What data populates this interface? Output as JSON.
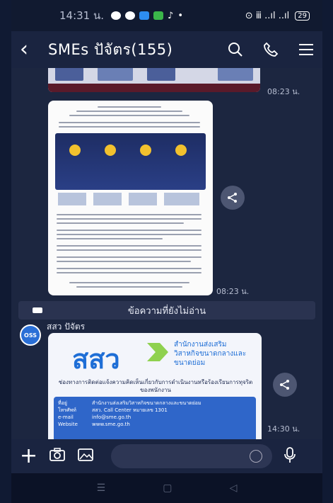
{
  "status_bar": {
    "time": "14:31 น.",
    "right": "⊙ ⅲ ..ıl ..ıl",
    "battery": "29"
  },
  "header": {
    "title": "SMEs ปัจัตร(155)"
  },
  "messages": {
    "img_time": "08:23 น.",
    "doc_time": "08:23 น.",
    "card_time": "14:30 น."
  },
  "unread_divider": "ข้อความที่ยังไม่อ่าน",
  "sender": {
    "name": "สสว ปัจัตร",
    "avatar_text": "OSS"
  },
  "card": {
    "logo": "สสว",
    "org": "สำนักงานส่งเสริมวิสาหกิจขนาดกลางและขนาดย่อม",
    "intro": "ช่องทางการติดต่อแจ้งความคิดเห็นเกี่ยวกับการดำเนินงานหรือร้องเรียนการทุจริตของพนักงาน",
    "rows": [
      {
        "k": "ที่อยู่",
        "v": "สำนักงานส่งเสริมวิสาหกิจขนาดกลางและขนาดย่อม"
      },
      {
        "k": "โทรศัพท์",
        "v": "สสว. Call Center หมายเลข 1301"
      },
      {
        "k": "e-mail",
        "v": "info@sme.go.th"
      },
      {
        "k": "Website",
        "v": "www.sme.go.th"
      }
    ]
  },
  "colors": {
    "accent": "#1e6ed6",
    "card_blue": "#2f66c9"
  }
}
